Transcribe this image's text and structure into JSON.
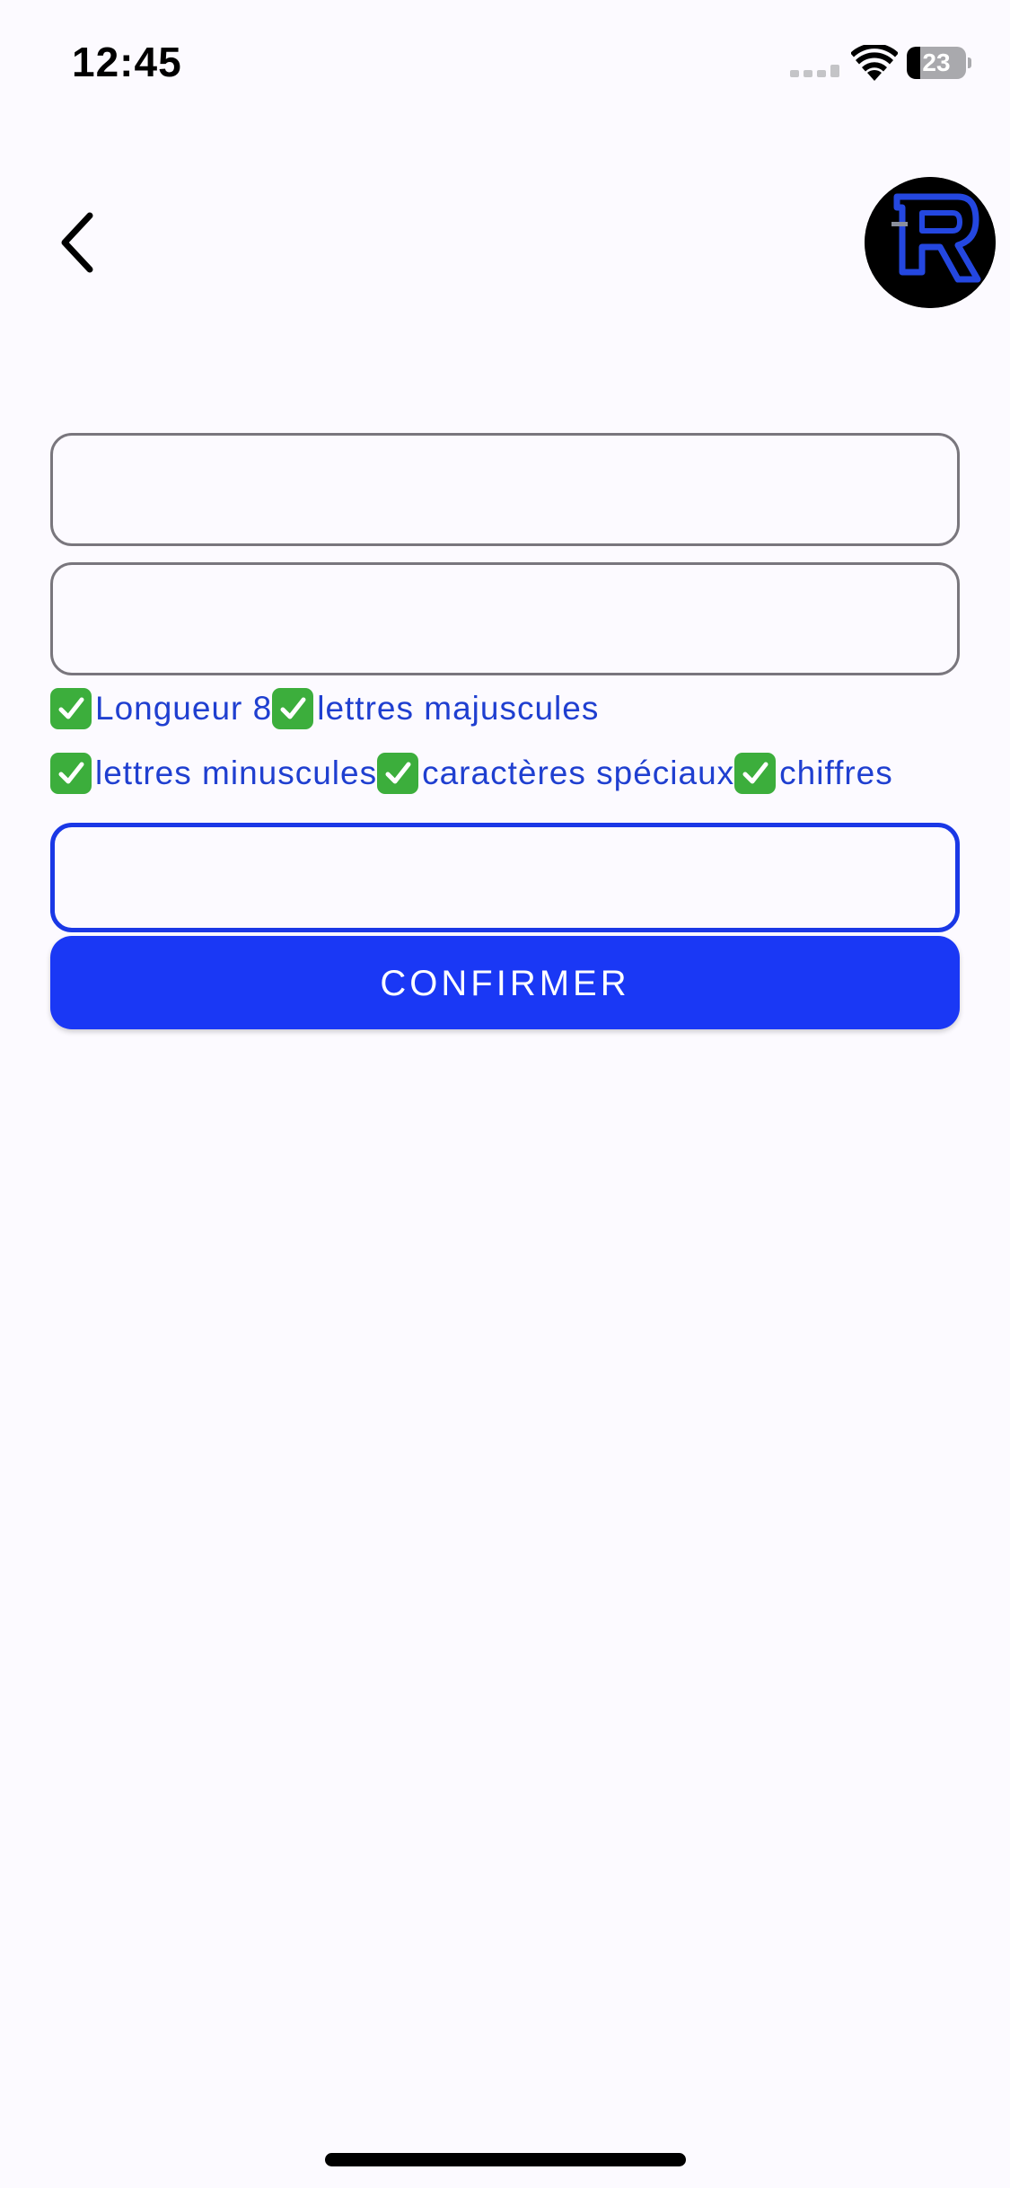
{
  "status_bar": {
    "time": "12:45",
    "battery_level": "23",
    "battery_fraction": 0.23
  },
  "header": {
    "back_icon": "chevron-left-icon",
    "logo_icon": "r-monogram-logo"
  },
  "form": {
    "field_1": {
      "value": "",
      "placeholder": ""
    },
    "field_2": {
      "value": "",
      "placeholder": ""
    },
    "field_3": {
      "value": "",
      "placeholder": ""
    },
    "rules": [
      {
        "label": "Longueur 8",
        "met": true
      },
      {
        "label": "lettres majuscules",
        "met": true
      },
      {
        "label": "lettres minuscules",
        "met": true
      },
      {
        "label": "caractères spéciaux",
        "met": true
      },
      {
        "label": "chiffres",
        "met": true
      }
    ],
    "confirm_label": "CONFIRMER"
  },
  "colors": {
    "accent": "#1a38f5",
    "rule_text": "#1f3fd0",
    "check": "#3cae3c",
    "background": "#fcfaff"
  }
}
